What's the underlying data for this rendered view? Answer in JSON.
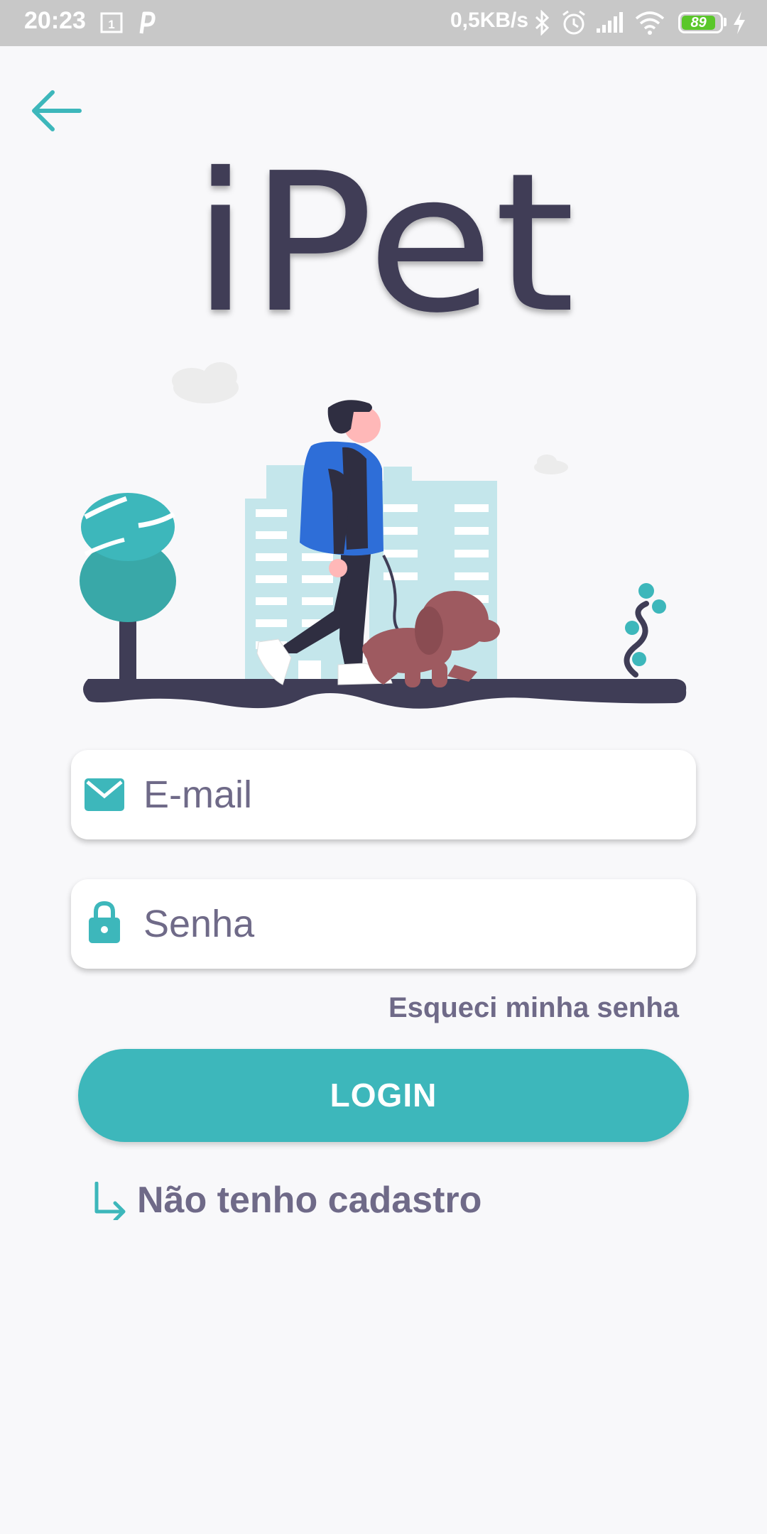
{
  "status_bar": {
    "time": "20:23",
    "network_speed": "0,5KB/s",
    "battery_level": "89",
    "icons": [
      "sim-card-icon",
      "p-app-icon",
      "bluetooth-icon",
      "alarm-icon",
      "signal-icon",
      "wifi-icon",
      "battery-icon",
      "charging-icon"
    ]
  },
  "header": {
    "back_icon": "arrow-left-icon"
  },
  "logo": {
    "text": "iPet"
  },
  "form": {
    "email": {
      "placeholder": "E-mail",
      "value": "",
      "icon": "mail-icon"
    },
    "password": {
      "placeholder": "Senha",
      "value": "",
      "icon": "lock-icon"
    },
    "forgot_password": "Esqueci minha senha",
    "login_label": "LOGIN",
    "register_label": "Não tenho cadastro",
    "register_icon": "arrow-down-right-icon"
  },
  "colors": {
    "accent": "#3db7bb",
    "text_muted": "#6f6a88",
    "logo_dark": "#3f3d56",
    "background": "#f8f8fa"
  }
}
